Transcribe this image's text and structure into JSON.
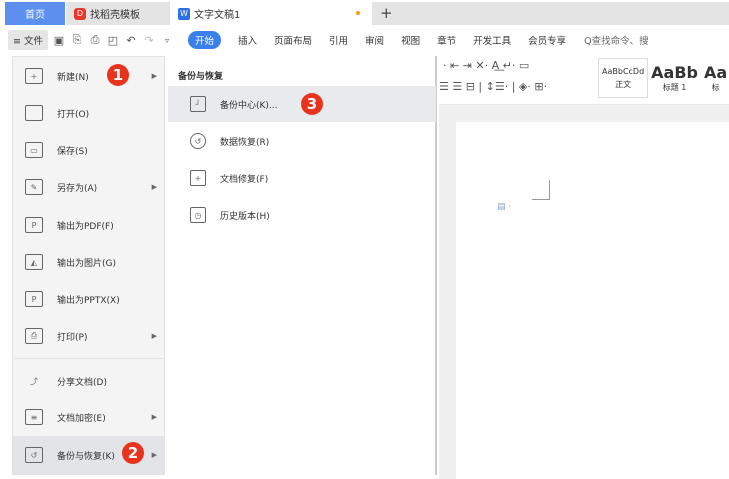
{
  "tabs": {
    "home": "首页",
    "template": "找稻壳模板",
    "doc": "文字文稿1",
    "new_tab": "+"
  },
  "toolbar": {
    "file": "≡ 文件",
    "start": "开始",
    "menus": [
      "插入",
      "页面布局",
      "引用",
      "审阅",
      "视图",
      "章节",
      "开发工具",
      "会员专享"
    ],
    "search": "Q查找命令、搜"
  },
  "file_menu": {
    "items": [
      {
        "label": "新建(N)",
        "icon": "new-doc-icon",
        "submenu": true
      },
      {
        "label": "打开(O)",
        "icon": "folder-icon",
        "submenu": false
      },
      {
        "label": "保存(S)",
        "icon": "save-icon",
        "submenu": false
      },
      {
        "label": "另存为(A)",
        "icon": "save-as-icon",
        "submenu": true
      },
      {
        "label": "输出为PDF(F)",
        "icon": "pdf-export-icon",
        "submenu": false
      },
      {
        "label": "输出为图片(G)",
        "icon": "image-export-icon",
        "submenu": false
      },
      {
        "label": "输出为PPTX(X)",
        "icon": "pptx-export-icon",
        "submenu": false
      },
      {
        "label": "打印(P)",
        "icon": "print-icon",
        "submenu": true
      },
      {
        "label": "分享文档(D)",
        "icon": "share-icon",
        "submenu": false
      },
      {
        "label": "文档加密(E)",
        "icon": "encrypt-icon",
        "submenu": true
      },
      {
        "label": "备份与恢复(K)",
        "icon": "backup-icon",
        "submenu": true,
        "highlighted": true
      }
    ]
  },
  "submenu": {
    "title": "备份与恢复",
    "items": [
      {
        "label": "备份中心(K)...",
        "icon": "backup-center-icon",
        "highlighted": true
      },
      {
        "label": "数据恢复(R)",
        "icon": "data-recovery-icon"
      },
      {
        "label": "文档修复(F)",
        "icon": "doc-repair-icon"
      },
      {
        "label": "历史版本(H)",
        "icon": "history-icon"
      }
    ]
  },
  "badges": [
    "1",
    "2",
    "3"
  ],
  "ribbon": {
    "styles": [
      {
        "preview": "AaBbCcDd",
        "name": "正文"
      },
      {
        "preview": "AaBb",
        "name": "标题 1"
      },
      {
        "preview": "Aa",
        "name": "标"
      }
    ]
  },
  "colors": {
    "accent": "#3a80ec",
    "badge": "#e8341f",
    "home_tab": "#5c8fee"
  }
}
